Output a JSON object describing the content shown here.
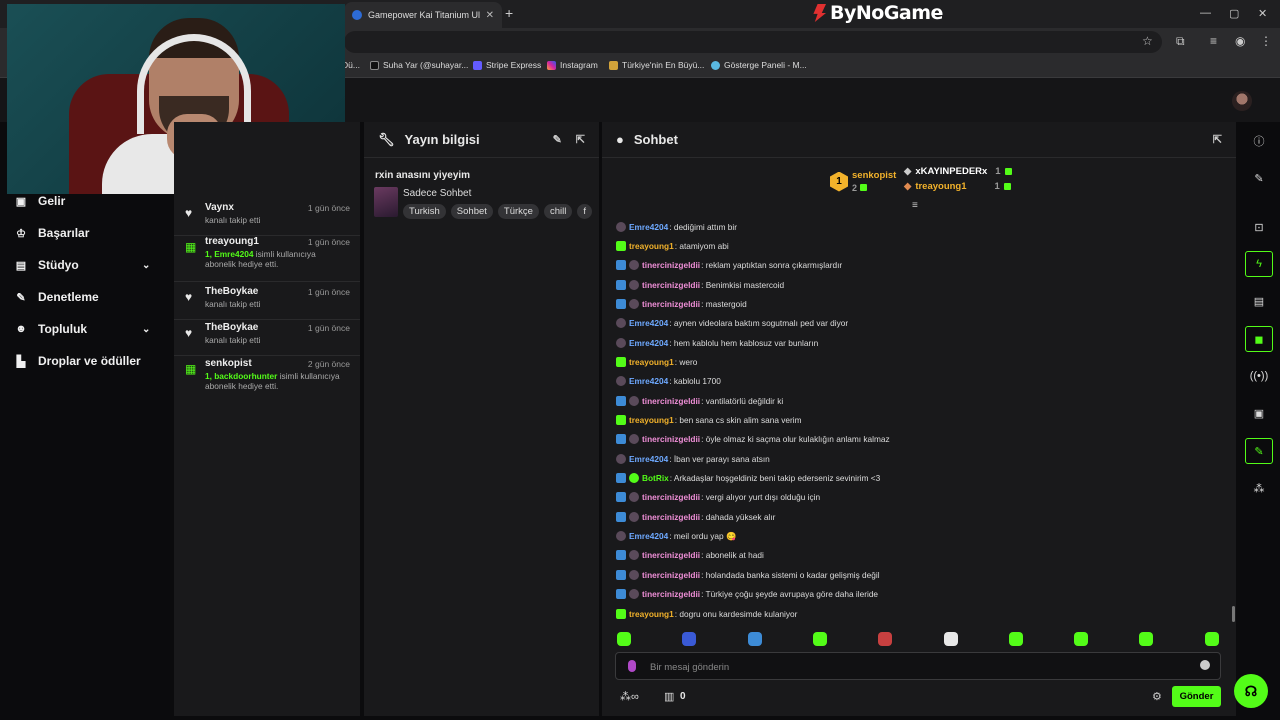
{
  "browser": {
    "tab_title": "Gamepower Kai Titanium Ultra",
    "brand": "ByNoGame",
    "bookmarks": [
      "Suha Yar (@suhayar...",
      "Stripe Express",
      "Instagram",
      "Türkiye'nin En Büyü...",
      "Gösterge Paneli - M..."
    ]
  },
  "nav": {
    "items": [
      "Gelir",
      "Başarılar",
      "Stüdyo",
      "Denetleme",
      "Topluluk",
      "Droplar ve ödüller"
    ]
  },
  "activity": [
    {
      "name": "Vaynx",
      "time": "1 gün önce",
      "desc": "kanalı takip etti",
      "type": "follow"
    },
    {
      "name": "treayoung1",
      "time": "1 gün önce",
      "desc_hl": "1, Emre4204",
      "desc": " isimli kullanıcıya abonelik hediye etti.",
      "type": "gift"
    },
    {
      "name": "TheBoykae",
      "time": "1 gün önce",
      "desc": "kanalı takip etti",
      "type": "follow"
    },
    {
      "name": "TheBoykae",
      "time": "1 gün önce",
      "desc": "kanalı takip etti",
      "type": "follow"
    },
    {
      "name": "senkopist",
      "time": "2 gün önce",
      "desc_hl": "1, backdoorhunter",
      "desc": " isimli kullanıcıya abonelik hediye etti.",
      "type": "gift"
    }
  ],
  "stream_info": {
    "header": "Yayın bilgisi",
    "title": "rxin anasını yiyeyim",
    "category": "Sadece Sohbet",
    "tags": [
      "Turkish",
      "Sohbet",
      "Türkçe",
      "chill",
      "f"
    ]
  },
  "chat": {
    "header": "Sohbet",
    "leaderboard": {
      "first": {
        "name": "senkopist",
        "rank": "1",
        "count": "2"
      },
      "second": {
        "name": "xKAYINPEDERx",
        "count": "1"
      },
      "third": {
        "name": "treayoung1",
        "count": "1"
      }
    },
    "messages": [
      {
        "user": "Emre4204",
        "text": ": dediğimi attım bir",
        "color": "#6ea9ff",
        "badges": [
          "shield"
        ]
      },
      {
        "user": "treayoung1",
        "text": ": atamiyom abi",
        "color": "#f2b22b",
        "badges": [
          "gift"
        ]
      },
      {
        "user": "tinercinizgeldii",
        "text": ": reklam yaptıktan sonra çıkarmışlardır",
        "color": "#f08fd8",
        "badges": [
          "blue",
          "shield"
        ]
      },
      {
        "user": "tinercinizgeldii",
        "text": ": Benimkisi mastercoid",
        "color": "#f08fd8",
        "badges": [
          "blue",
          "shield"
        ]
      },
      {
        "user": "tinercinizgeldii",
        "text": ": mastergoid",
        "color": "#f08fd8",
        "badges": [
          "blue",
          "shield"
        ]
      },
      {
        "user": "Emre4204",
        "text": ": aynen videolara baktım sogutmalı ped var diyor",
        "color": "#6ea9ff",
        "badges": [
          "shield"
        ]
      },
      {
        "user": "Emre4204",
        "text": ": hem kablolu hem kablosuz var bunların",
        "color": "#6ea9ff",
        "badges": [
          "shield"
        ]
      },
      {
        "user": "treayoung1",
        "text": ": wero",
        "color": "#f2b22b",
        "badges": [
          "gift"
        ]
      },
      {
        "user": "Emre4204",
        "text": ": kablolu 1700",
        "color": "#6ea9ff",
        "badges": [
          "shield"
        ]
      },
      {
        "user": "tinercinizgeldii",
        "text": ": vantilatörlü değildir ki",
        "color": "#f08fd8",
        "badges": [
          "blue",
          "shield"
        ]
      },
      {
        "user": "treayoung1",
        "text": ": ben sana cs skin alim sana verim",
        "color": "#f2b22b",
        "badges": [
          "gift"
        ]
      },
      {
        "user": "tinercinizgeldii",
        "text": ": öyle olmaz ki saçma olur kulaklığın anlamı kalmaz",
        "color": "#f08fd8",
        "badges": [
          "blue",
          "shield"
        ]
      },
      {
        "user": "Emre4204",
        "text": ": İban ver parayı sana atsın",
        "color": "#6ea9ff",
        "badges": [
          "shield"
        ]
      },
      {
        "user": "BotRix",
        "text": ": Arkadaşlar hoşgeldiniz beni takip ederseniz sevinirim <3",
        "color": "#53fc18",
        "badges": [
          "blue",
          "check"
        ]
      },
      {
        "user": "tinercinizgeldii",
        "text": ": vergi alıyor yurt dışı olduğu için",
        "color": "#f08fd8",
        "badges": [
          "blue",
          "shield"
        ]
      },
      {
        "user": "tinercinizgeldii",
        "text": ": dahada yüksek alır",
        "color": "#f08fd8",
        "badges": [
          "blue",
          "shield"
        ]
      },
      {
        "user": "Emre4204",
        "text": ": meil ordu yap 😋",
        "color": "#6ea9ff",
        "badges": [
          "shield"
        ]
      },
      {
        "user": "tinercinizgeldii",
        "text": ": abonelik at hadi",
        "color": "#f08fd8",
        "badges": [
          "blue",
          "shield"
        ]
      },
      {
        "user": "tinercinizgeldii",
        "text": ": holandada banka sistemi o kadar gelişmiş değil",
        "color": "#f08fd8",
        "badges": [
          "blue",
          "shield"
        ]
      },
      {
        "user": "tinercinizgeldii",
        "text": ": Türkiye çoğu şeyde avrupaya göre daha ileride",
        "color": "#f08fd8",
        "badges": [
          "blue",
          "shield"
        ]
      },
      {
        "user": "treayoung1",
        "text": ": dogru onu kardesimde kulaniyor",
        "color": "#f2b22b",
        "badges": [
          "gift"
        ]
      }
    ],
    "input_placeholder": "Bir mesaj gönderin",
    "points": "0",
    "send_label": "Gönder"
  },
  "colors": {
    "accent": "#53fc18",
    "panel": "#19191b",
    "background": "#0b0b0d"
  }
}
